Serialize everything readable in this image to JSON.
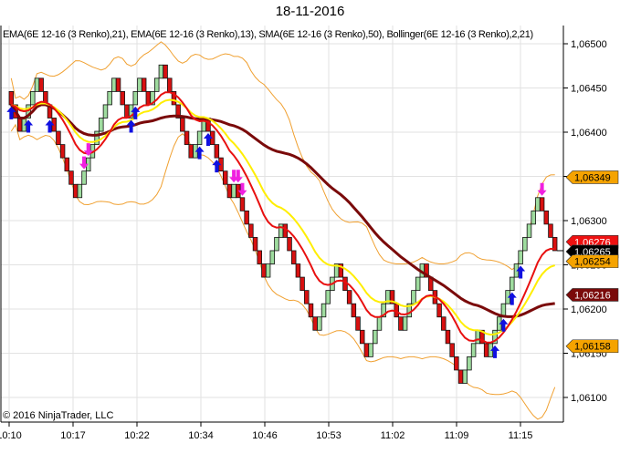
{
  "title": "18-11-2016",
  "legend": "EMA(6E 12-16 (3 Renko),21), EMA(6E 12-16 (3 Renko),13), SMA(6E 12-16 (3 Renko),50), Bollinger(6E 12-16 (3 Renko),2,21)",
  "copyright": "© 2016 NinjaTrader, LLC",
  "chart_data": {
    "type": "renko",
    "instrument": "6E 12-16 (3 Renko)",
    "brick_size": 0.00015,
    "start_price": 1.06446,
    "moves": [
      -3,
      4,
      -9,
      9,
      -3,
      3,
      -2,
      3,
      -7,
      3,
      -6,
      1,
      -7,
      4,
      -8,
      5,
      -7,
      5,
      -3,
      5,
      -9,
      4,
      -2,
      12,
      -4
    ],
    "ylim": [
      1.0608,
      1.0652
    ],
    "y_ticks": [
      "1,06500",
      "1,06450",
      "1,06400",
      "1,06350",
      "1,06300",
      "1,06250",
      "1,06200",
      "1,06150",
      "1,06100"
    ],
    "y_tick_values": [
      1.065,
      1.0645,
      1.064,
      1.0635,
      1.063,
      1.0625,
      1.062,
      1.0615,
      1.061
    ],
    "x_ticks": [
      "10:10",
      "10:17",
      "10:22",
      "10:34",
      "10:46",
      "10:53",
      "11:02",
      "11:09",
      "11:15"
    ],
    "series": [
      {
        "name": "EMA 13",
        "color": "#e81010"
      },
      {
        "name": "EMA 21",
        "color": "#ffee00"
      },
      {
        "name": "SMA 50",
        "color": "#7a0a0a"
      },
      {
        "name": "Bollinger 2,21",
        "color": "#f0a030"
      }
    ],
    "price_tags": [
      {
        "label": "1,06349",
        "value": 1.06349,
        "bg": "#f5a300",
        "fg": "#000000"
      },
      {
        "label": "1,06276",
        "value": 1.06276,
        "bg": "#ee1111",
        "fg": "#ffffff"
      },
      {
        "label": "1,06265",
        "value": 1.06265,
        "bg": "#000000",
        "fg": "#ffffff"
      },
      {
        "label": "1,06254",
        "value": 1.06254,
        "bg": "#f5a300",
        "fg": "#000000"
      },
      {
        "label": "1,06216",
        "value": 1.06216,
        "bg": "#7a0a0a",
        "fg": "#ffffff"
      },
      {
        "label": "1,06158",
        "value": 1.06158,
        "bg": "#f5a300",
        "fg": "#000000"
      }
    ],
    "markers": [
      {
        "brick": 0,
        "type": "buy"
      },
      {
        "brick": 4,
        "type": "buy"
      },
      {
        "brick": 9,
        "type": "buy"
      },
      {
        "brick": 17,
        "type": "sell"
      },
      {
        "brick": 18,
        "type": "sell"
      },
      {
        "brick": 28,
        "type": "buy"
      },
      {
        "brick": 29,
        "type": "buy"
      },
      {
        "brick": 44,
        "type": "buy"
      },
      {
        "brick": 46,
        "type": "buy"
      },
      {
        "brick": 48,
        "type": "buy"
      },
      {
        "brick": 52,
        "type": "sell"
      },
      {
        "brick": 53,
        "type": "sell"
      },
      {
        "brick": 54,
        "type": "sell"
      },
      {
        "brick": 113,
        "type": "buy"
      },
      {
        "brick": 115,
        "type": "buy"
      },
      {
        "brick": 117,
        "type": "buy"
      },
      {
        "brick": 119,
        "type": "buy"
      },
      {
        "brick": 124,
        "type": "sell"
      }
    ]
  }
}
